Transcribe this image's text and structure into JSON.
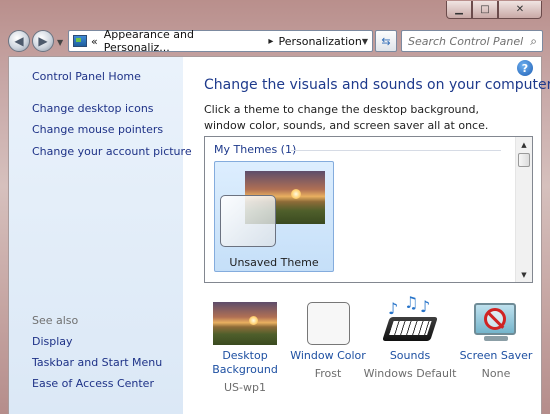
{
  "window": {
    "minimize_glyph": "▁",
    "maximize_glyph": "□",
    "close_glyph": "✕"
  },
  "address": {
    "back_glyph": "◀",
    "forward_glyph": "▶",
    "crumb_prefix": "«",
    "crumb_1": "Appearance and Personaliz...",
    "crumb_arrow": "▸",
    "crumb_2": "Personalization",
    "dropdown_glyph": "▼",
    "refresh_glyph": "⇆",
    "search_placeholder": "Search Control Panel",
    "search_icon": "⌕"
  },
  "sidebar": {
    "home": "Control Panel Home",
    "links": [
      "Change desktop icons",
      "Change mouse pointers",
      "Change your account picture"
    ],
    "see_also_heading": "See also",
    "see_also": [
      "Display",
      "Taskbar and Start Menu",
      "Ease of Access Center"
    ]
  },
  "main": {
    "help_glyph": "?",
    "title": "Change the visuals and sounds on your computer",
    "description": "Click a theme to change the desktop background, window color, sounds, and screen saver all at once.",
    "group_heading": "My Themes (1)",
    "theme_label": "Unsaved Theme"
  },
  "options": [
    {
      "title": "Desktop Background",
      "value": "US-wp1"
    },
    {
      "title": "Window Color",
      "value": "Frost"
    },
    {
      "title": "Sounds",
      "value": "Windows Default"
    },
    {
      "title": "Screen Saver",
      "value": "None"
    }
  ],
  "icons": {
    "back": "back-arrow-icon",
    "forward": "forward-arrow-icon",
    "control_panel": "control-panel-icon",
    "refresh": "refresh-icon",
    "search": "search-icon",
    "help": "help-icon",
    "sound": "music-notes-keyboard-icon",
    "screensaver": "monitor-no-sign-icon"
  }
}
